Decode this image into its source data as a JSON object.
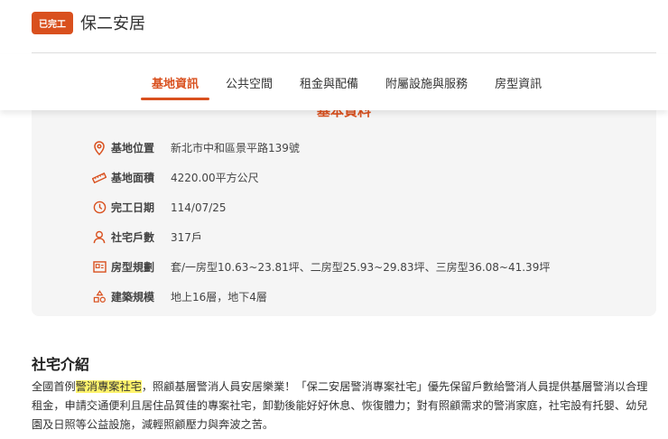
{
  "header": {
    "badge": "已完工",
    "title": "保二安居"
  },
  "tabs": [
    {
      "label": "基地資訊"
    },
    {
      "label": "公共空間"
    },
    {
      "label": "租金與配備"
    },
    {
      "label": "附屬設施與服務"
    },
    {
      "label": "房型資訊"
    }
  ],
  "card": {
    "title": "基本資料",
    "rows": [
      {
        "icon": "location-pin-icon",
        "label": "基地位置",
        "value": "新北市中和區景平路139號"
      },
      {
        "icon": "ruler-icon",
        "label": "基地面積",
        "value": "4220.00平方公尺"
      },
      {
        "icon": "clock-icon",
        "label": "完工日期",
        "value": "114/07/25"
      },
      {
        "icon": "person-icon",
        "label": "社宅戶數",
        "value": "317戶"
      },
      {
        "icon": "floorplan-icon",
        "label": "房型規劃",
        "value": "套/一房型10.63~23.81坪、二房型25.93~29.83坪、三房型36.08~41.39坪"
      },
      {
        "icon": "shapes-icon",
        "label": "建築規模",
        "value": "地上16層，地下4層"
      }
    ]
  },
  "intro": {
    "title": "社宅介紹",
    "prefix": "全國首例",
    "highlight": "警消專案社宅",
    "body": "，照顧基層警消人員安居樂業！「保二安居警消專案社宅」優先保留戶數給警消人員提供基層警消以合理租金，申請交通便利且居住品質佳的專案社宅，卸勤後能好好休息、恢復體力；對有照顧需求的警消家庭，社宅設有托嬰、幼兒園及日照等公益設施，減輕照顧壓力與奔波之苦。"
  },
  "colors": {
    "accent": "#d9501e",
    "highlight": "#fff36b"
  }
}
